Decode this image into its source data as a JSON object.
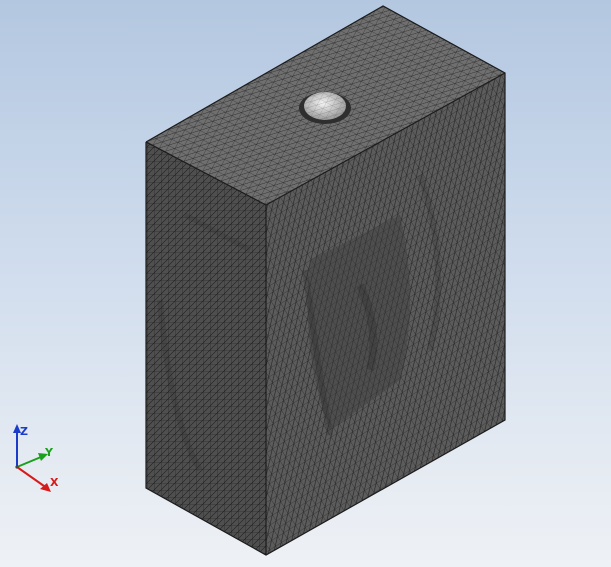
{
  "scene": {
    "model": "meshed-block-with-spherical-cap",
    "mesh": "triangular-surface-mesh",
    "colors": {
      "background_top": "#b3c7e0",
      "background_bottom": "#eef1f5",
      "face_top": "#6f6f6f",
      "face_front": "#4f4f4f",
      "face_right": "#5c5c5c",
      "mesh_lines": "#1a1a1a",
      "cap": "#d9d9d9"
    }
  },
  "triad": {
    "z_label": "Z",
    "y_label": "Y",
    "x_label": "X",
    "colors": {
      "z": "#1a3cc8",
      "y": "#1aa01a",
      "x": "#d81a1a"
    }
  }
}
